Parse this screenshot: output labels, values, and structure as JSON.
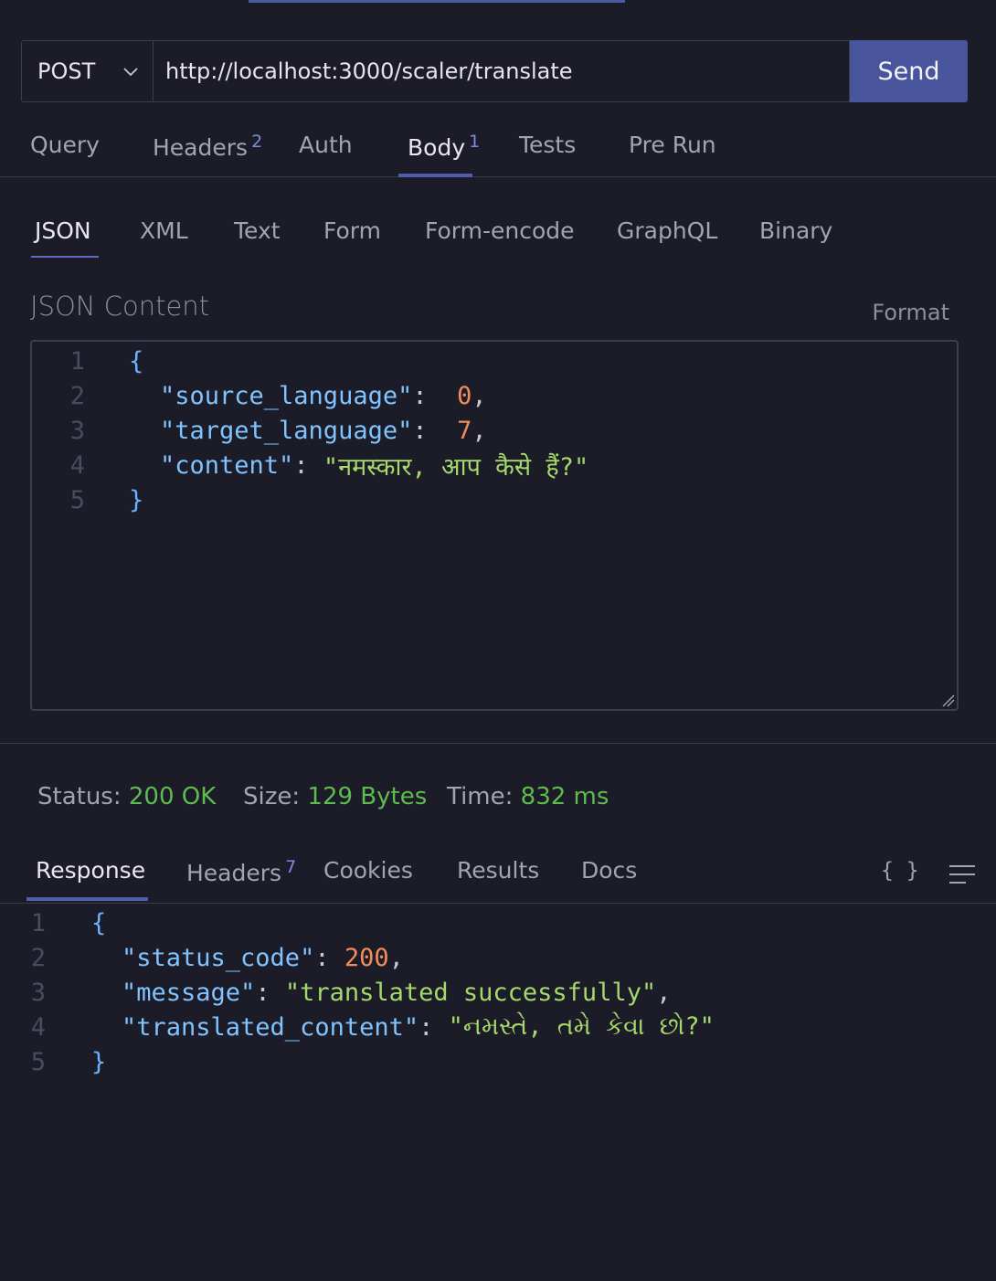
{
  "request": {
    "method": "POST",
    "url": "http://localhost:3000/scaler/translate",
    "send_label": "Send"
  },
  "request_tabs": [
    {
      "label": "Query"
    },
    {
      "label": "Headers",
      "badge": "2"
    },
    {
      "label": "Auth"
    },
    {
      "label": "Body",
      "badge": "1",
      "active": true
    },
    {
      "label": "Tests"
    },
    {
      "label": "Pre Run"
    }
  ],
  "body_tabs": [
    {
      "label": "JSON",
      "active": true
    },
    {
      "label": "XML"
    },
    {
      "label": "Text"
    },
    {
      "label": "Form"
    },
    {
      "label": "Form-encode"
    },
    {
      "label": "GraphQL"
    },
    {
      "label": "Binary"
    }
  ],
  "editor": {
    "title": "JSON Content",
    "format_label": "Format",
    "lines": [
      {
        "n": "1",
        "brace": "{"
      },
      {
        "n": "2",
        "key": "\"source_language\"",
        "sep": ":  ",
        "num": "0",
        "tail": ","
      },
      {
        "n": "3",
        "key": "\"target_language\"",
        "sep": ":  ",
        "num": "7",
        "tail": ","
      },
      {
        "n": "4",
        "key": "\"content\"",
        "sep": ": ",
        "str": "\"नमस्कार, आप कैसे हैं?\""
      },
      {
        "n": "5",
        "brace": "}"
      }
    ]
  },
  "status": {
    "status_label": "Status:",
    "status_value": "200 OK",
    "size_label": "Size:",
    "size_value": "129 Bytes",
    "time_label": "Time:",
    "time_value": "832 ms"
  },
  "response_tabs": [
    {
      "label": "Response",
      "active": true
    },
    {
      "label": "Headers",
      "badge": "7"
    },
    {
      "label": "Cookies"
    },
    {
      "label": "Results"
    },
    {
      "label": "Docs"
    }
  ],
  "response_icons": {
    "braces_icon": "{ }",
    "menu_icon": "menu-icon"
  },
  "response_body": {
    "lines": [
      {
        "n": "1",
        "brace": "{"
      },
      {
        "n": "2",
        "key": "\"status_code\"",
        "sep": ": ",
        "num": "200",
        "tail": ","
      },
      {
        "n": "3",
        "key": "\"message\"",
        "sep": ": ",
        "str": "\"translated successfully\"",
        "tail": ","
      },
      {
        "n": "4",
        "key": "\"translated_content\"",
        "sep": ": ",
        "str": "\"નમસ્તે, તમે કેવા છો?\""
      },
      {
        "n": "5",
        "brace": "}"
      }
    ]
  },
  "colors": {
    "background": "#1b1c27",
    "accent": "#48549b",
    "status_ok": "#5dbb4f",
    "json_key": "#7fc3ff",
    "json_number": "#f08d5a",
    "json_string": "#a6d86b"
  }
}
